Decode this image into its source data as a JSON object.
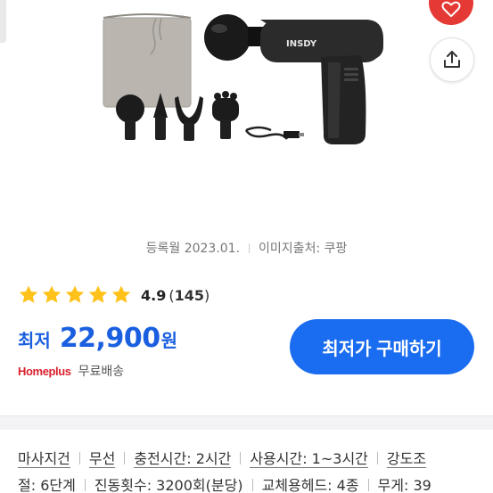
{
  "meta": {
    "registered": "등록월 2023.01.",
    "image_source": "이미지출처: 쿠팡"
  },
  "rating": {
    "value": "4.9",
    "count_open": "(",
    "count": "145",
    "count_close": ")",
    "stars_filled": 5
  },
  "price": {
    "label": "최저",
    "value": "22,900",
    "unit": "원"
  },
  "shop": {
    "logo_text": "Homeplus",
    "shipping": "무료배송"
  },
  "buy_button": {
    "label": "최저가 구매하기"
  },
  "product": {
    "brand_text": "INSDY"
  },
  "specs": {
    "line1": [
      "마사지건",
      "무선",
      "충전시간: 2시간",
      "사용시간: 1~3시간",
      "강도조"
    ],
    "line2": [
      "절: 6단계",
      "진동횟수: 3200회(분당)",
      "교체용헤드: 4종",
      "무게: 39"
    ]
  },
  "colors": {
    "accent_blue": "#1a6cf0",
    "price_blue": "#1a5fe0",
    "star_yellow": "#ffc21a",
    "wish_red": "#e53935",
    "homeplus_red": "#d9232e"
  },
  "icons": {
    "wish": "heart-icon",
    "share": "share-icon",
    "star": "star-icon"
  }
}
